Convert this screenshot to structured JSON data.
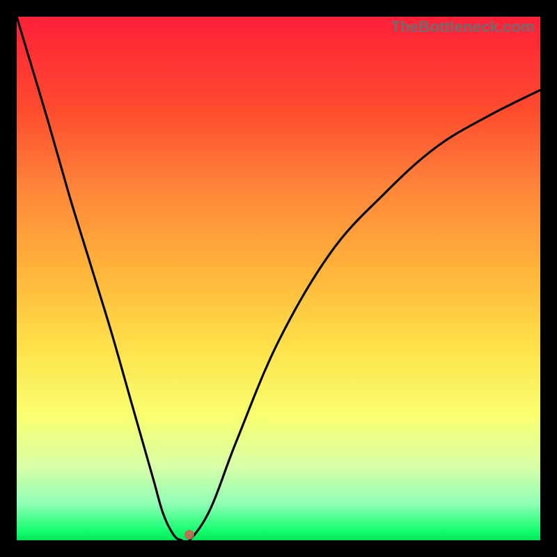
{
  "watermark": "TheBottleneck.com",
  "chart_data": {
    "type": "line",
    "title": "",
    "xlabel": "",
    "ylabel": "",
    "x_range": [
      0,
      1
    ],
    "y_range": [
      0,
      1
    ],
    "series": [
      {
        "name": "curve",
        "x": [
          0.0,
          0.03,
          0.06,
          0.1,
          0.14,
          0.18,
          0.22,
          0.26,
          0.28,
          0.3,
          0.315,
          0.33,
          0.37,
          0.42,
          0.5,
          0.6,
          0.7,
          0.8,
          0.9,
          1.0
        ],
        "y": [
          1.0,
          0.9,
          0.8,
          0.66,
          0.53,
          0.4,
          0.26,
          0.12,
          0.05,
          0.01,
          0.0,
          0.0,
          0.06,
          0.19,
          0.38,
          0.55,
          0.66,
          0.75,
          0.81,
          0.86
        ]
      }
    ],
    "marker": {
      "x": 0.33,
      "y": 0.01
    },
    "gradient_stops": [
      {
        "pos": 0.0,
        "color": "#ff1f39"
      },
      {
        "pos": 0.18,
        "color": "#ff4c2e"
      },
      {
        "pos": 0.33,
        "color": "#ff863a"
      },
      {
        "pos": 0.49,
        "color": "#ffb63a"
      },
      {
        "pos": 0.63,
        "color": "#ffe14b"
      },
      {
        "pos": 0.76,
        "color": "#f9ff6e"
      },
      {
        "pos": 0.86,
        "color": "#d8ffa8"
      },
      {
        "pos": 0.93,
        "color": "#8fffb5"
      },
      {
        "pos": 0.98,
        "color": "#18ff72"
      },
      {
        "pos": 1.0,
        "color": "#00e858"
      }
    ]
  }
}
